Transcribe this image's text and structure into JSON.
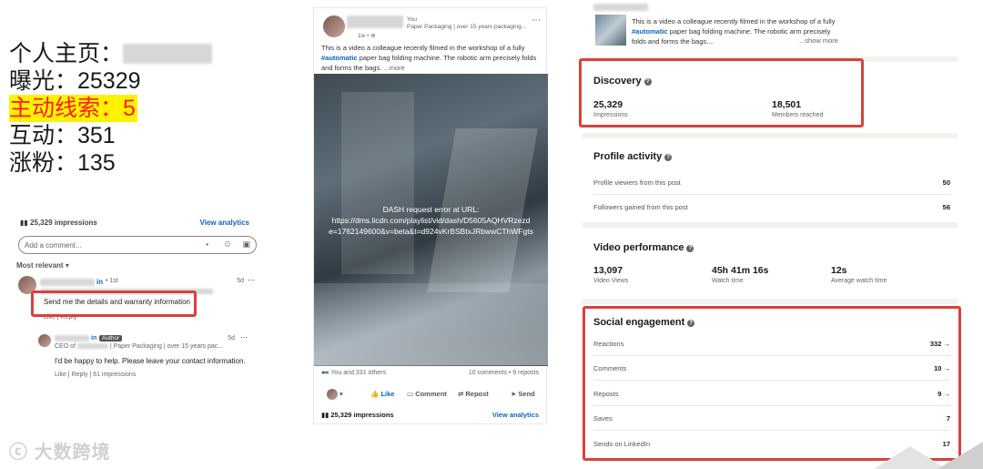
{
  "summary": {
    "profile_label": "个人主页：",
    "exposure": "曝光：25329",
    "leads": "主动线索：5",
    "interactions": "互动：351",
    "followers": "涨粉：135"
  },
  "comments_panel": {
    "impressions": "25,329 impressions",
    "view_analytics": "View analytics",
    "add_comment_placeholder": "Add a comment...",
    "most_relevant": "Most relevant",
    "comment1": {
      "degree": "1st",
      "time": "5d",
      "text": "Send me the details and warranty information",
      "like": "Like",
      "reply": "Reply"
    },
    "comment2": {
      "author_badge": "Author",
      "subtitle": "Paper Packaging | over 15 years pac...",
      "ceo": "CEO of",
      "time": "5d",
      "text": "I'd be happy to help. Please leave your contact information.",
      "like": "Like",
      "reply": "Reply",
      "impressions": "61 impressions"
    }
  },
  "post": {
    "author_you": "You",
    "author_subtitle": "Paper Packaging | over 15 years packaging...",
    "time": "1w •",
    "text_before": "This is a video a colleague recently filmed in the workshop of a fully ",
    "hashtag": "#automatic",
    "text_after": " paper bag folding machine. The robotic arm precisely folds and forms the bags.",
    "more": "...more",
    "video_error_line1": "DASH request error at URL:",
    "video_error_line2": "https://dms.licdn.com/playlist/vid/dash/D5605AQHVRzezd",
    "video_error_line3": "e=1762149600&v=beta&t=d924vKrBSBtxJRbwwCThWFgts",
    "reactions": "You and 331 others",
    "comments_reposts": "10 comments • 9 reposts",
    "actions": [
      "Like",
      "Comment",
      "Repost",
      "Send"
    ],
    "impressions": "25,329 impressions",
    "view_analytics": "View analytics"
  },
  "analytics": {
    "top_snippet_before": "This is a video a colleague recently filmed in the workshop of a fully ",
    "top_snippet_hashtag": "#automatic",
    "top_snippet_after": " paper bag folding machine. The robotic arm precisely folds and forms the bags....",
    "show_more": "...show more",
    "discovery": {
      "title": "Discovery",
      "impressions_value": "25,329",
      "impressions_label": "Impressions",
      "members_value": "18,501",
      "members_label": "Members reached"
    },
    "profile_activity": {
      "title": "Profile activity",
      "rows": [
        {
          "label": "Profile viewers from this post",
          "value": "50"
        },
        {
          "label": "Followers gained from this post",
          "value": "56"
        }
      ]
    },
    "video_performance": {
      "title": "Video performance",
      "views_value": "13,097",
      "views_label": "Video Views",
      "watch_value": "45h 41m 16s",
      "watch_label": "Watch time",
      "avg_value": "12s",
      "avg_label": "Average watch time"
    },
    "social_engagement": {
      "title": "Social engagement",
      "rows": [
        {
          "label": "Reactions",
          "value": "332 →"
        },
        {
          "label": "Comments",
          "value": "10 →"
        },
        {
          "label": "Reposts",
          "value": "9 →"
        },
        {
          "label": "Saves",
          "value": "7"
        },
        {
          "label": "Sends on LinkedIn",
          "value": "17"
        }
      ]
    }
  },
  "watermark": "大数跨境"
}
